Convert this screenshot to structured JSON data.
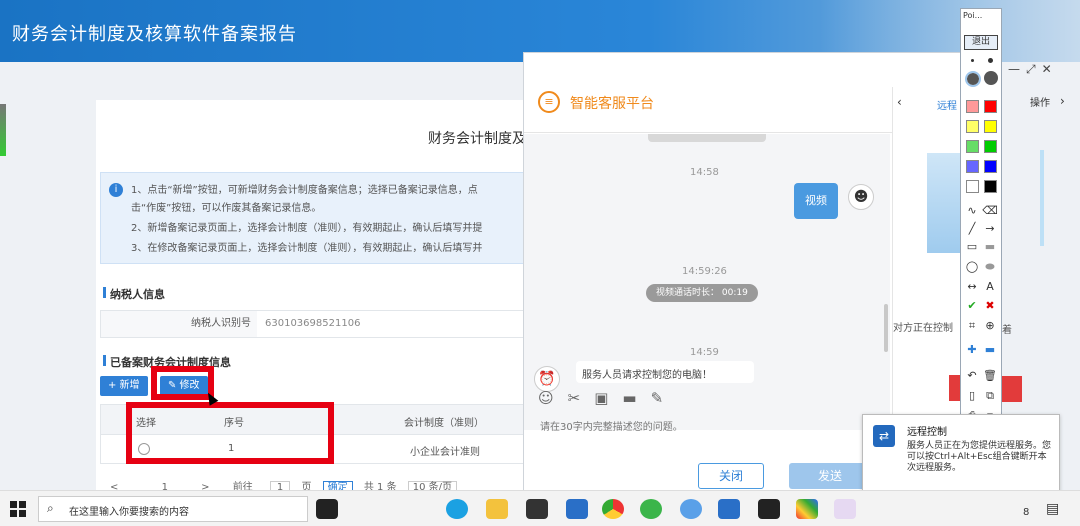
{
  "header": {
    "title": "财务会计制度及核算软件备案报告"
  },
  "page": {
    "title": "财务会计制度及",
    "info_lines": [
      "1、点击“新增”按钮，可新增财务会计制度备案信息；选择已备案记录信息，点",
      "击“作废”按钮，可以作废其备案记录信息。",
      "2、新增备案记录页面上，选择会计制度（准则），有效期起止，确认后填写并提",
      "3、在修改备案记录页面上，选择会计制度（准则），有效期起止，确认后填写并"
    ],
    "taxpayer_section": "纳税人信息",
    "taxpayer_id_label": "纳税人识别号",
    "taxpayer_id_value": "630103698521106",
    "records_section": "已备案财务会计制度信息",
    "add_button": "+ 新增",
    "edit_button": "✎ 修改",
    "table": {
      "headers": [
        "选择",
        "序号",
        "会计制度（准则）"
      ],
      "rows": [
        [
          "",
          "1",
          "小企业会计准则"
        ]
      ]
    },
    "pager": {
      "prev": "<",
      "page": "1",
      "next": ">",
      "goto": "前往",
      "page_input": "1",
      "page_unit": "页",
      "confirm": "确定",
      "total": "共 1 条",
      "size": "10 条/页"
    }
  },
  "chat": {
    "platform_title": "智能客服平台",
    "time1": "14:58",
    "video_bubble": "视频",
    "time2": "14:59:26",
    "call_duration": "视频通话时长： 00:19",
    "time3": "14:59",
    "partial_msg": "服务人员请求控制您的电脑！",
    "input_hint": "请在30字内完整描述您的问题。",
    "close_button": "关闭",
    "send_button": "发送",
    "side_tab_remote": "远程",
    "side_tab_op": "操作",
    "side_text": "对方正在控制",
    "side_text_2": "着"
  },
  "palette": {
    "title": "Poi...",
    "exit": "退出",
    "colors": [
      "#ff9999",
      "#ff0000",
      "#ffff66",
      "#ffff00",
      "#66dd66",
      "#00cc00",
      "#6666ff",
      "#0000ff",
      "#ffffff",
      "#000000"
    ],
    "text_tool": "A"
  },
  "toast": {
    "title": "远程控制",
    "body": "服务人员正在为您提供远程服务。您可以按Ctrl+Alt+Esc组合键断开本次远程服务。"
  },
  "taskbar": {
    "search_placeholder": "在这里输入你要搜索的内容",
    "tray_number": "8"
  }
}
